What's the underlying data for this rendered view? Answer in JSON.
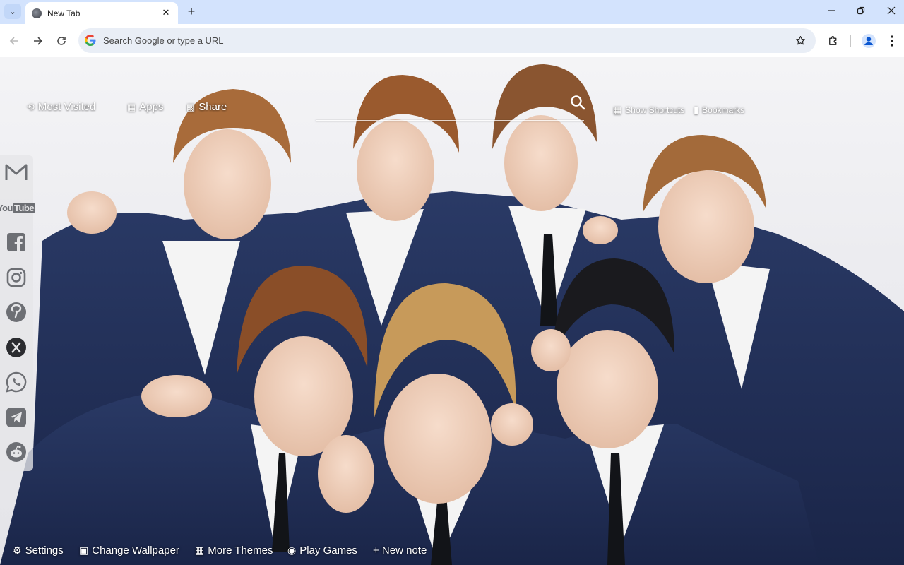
{
  "browser": {
    "tab": {
      "title": "New Tab"
    },
    "omnibox": {
      "placeholder": "Search Google or type a URL"
    }
  },
  "ntp": {
    "top_links": [
      {
        "label": "Most Visited",
        "icon": "history-icon"
      },
      {
        "label": "Apps",
        "icon": "grid-icon"
      },
      {
        "label": "Share",
        "icon": "share-icon"
      }
    ],
    "top_right_links": [
      {
        "label": "Show Shortcuts",
        "icon": "grid-icon"
      },
      {
        "label": "Bookmarks",
        "icon": "bookmark-icon"
      }
    ],
    "social_icons": [
      "gmail-icon",
      "youtube-icon",
      "facebook-icon",
      "instagram-icon",
      "pinterest-icon",
      "x-icon",
      "whatsapp-icon",
      "telegram-icon",
      "reddit-icon"
    ],
    "youtube_label": {
      "you": "You",
      "tube": "Tube"
    },
    "bottom_links": [
      {
        "label": "Settings",
        "icon": "gear-icon"
      },
      {
        "label": "Change Wallpaper",
        "icon": "image-icon"
      },
      {
        "label": "More Themes",
        "icon": "windows-icon"
      },
      {
        "label": "Play Games",
        "icon": "gamepad-icon"
      },
      {
        "label": "+ New note",
        "icon": ""
      }
    ]
  }
}
